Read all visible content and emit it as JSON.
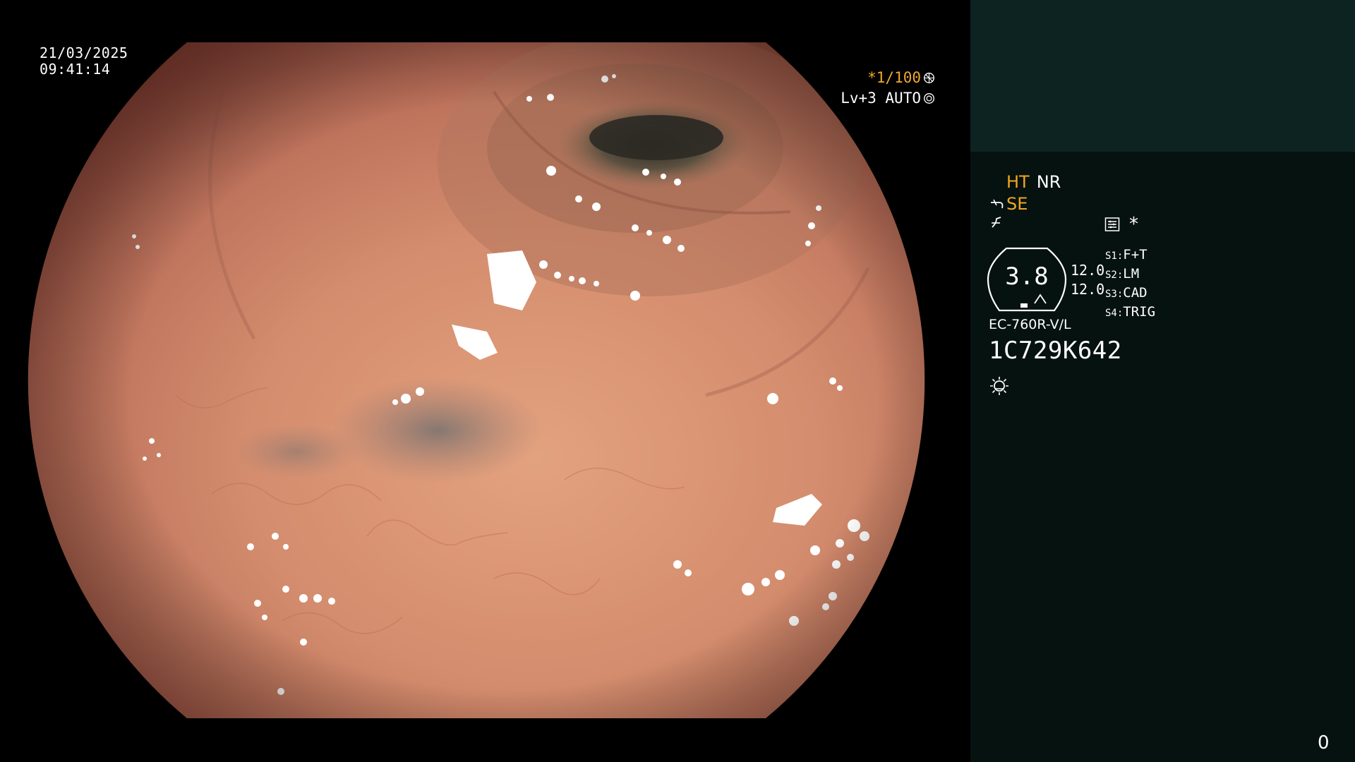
{
  "overlay": {
    "date": "21/03/2025",
    "time": "09:41:14",
    "shutter": "*1/100",
    "iris": "Lv+3 AUTO"
  },
  "panel": {
    "ht": "HT",
    "nr": "NR",
    "se": "SE",
    "asterisk": "*",
    "gauge_value": "3.8",
    "gauge_num_1": "12.0",
    "gauge_num_2": "12.0",
    "switches": [
      {
        "key": "S1:",
        "value": "F+T"
      },
      {
        "key": "S2:",
        "value": "LM"
      },
      {
        "key": "S3:",
        "value": "CAD"
      },
      {
        "key": "S4:",
        "value": "TRIG"
      }
    ],
    "scope_model": "EC-760R-V/L",
    "serial": "1C729K642",
    "counter": "0"
  },
  "colors": {
    "accent_orange": "#f2a71f",
    "panel_dark": "#061210",
    "panel_top": "#0d2322",
    "mucosa": "#c9826a"
  },
  "icons": [
    "shutter-ring-icon",
    "iris-ring-icon",
    "scope-curve-icon",
    "function-icon",
    "menu-icon",
    "brightness-icon",
    "gauge-icon"
  ]
}
